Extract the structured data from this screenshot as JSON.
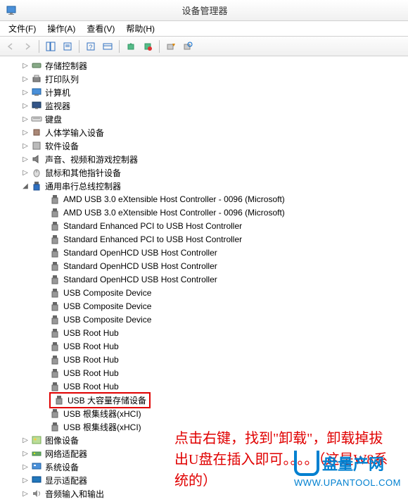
{
  "window": {
    "title": "设备管理器"
  },
  "menu": {
    "file": "文件(F)",
    "action": "操作(A)",
    "view": "查看(V)",
    "help": "帮助(H)"
  },
  "tree": {
    "categories": [
      {
        "label": "存储控制器",
        "expanded": false,
        "icon": "storage"
      },
      {
        "label": "打印队列",
        "expanded": false,
        "icon": "printer"
      },
      {
        "label": "计算机",
        "expanded": false,
        "icon": "computer"
      },
      {
        "label": "监视器",
        "expanded": false,
        "icon": "monitor"
      },
      {
        "label": "键盘",
        "expanded": false,
        "icon": "keyboard"
      },
      {
        "label": "人体学输入设备",
        "expanded": false,
        "icon": "hid"
      },
      {
        "label": "软件设备",
        "expanded": false,
        "icon": "software"
      },
      {
        "label": "声音、视频和游戏控制器",
        "expanded": false,
        "icon": "sound"
      },
      {
        "label": "鼠标和其他指针设备",
        "expanded": false,
        "icon": "mouse"
      },
      {
        "label": "通用串行总线控制器",
        "expanded": true,
        "icon": "usb",
        "children": [
          {
            "label": "AMD USB 3.0 eXtensible Host Controller - 0096 (Microsoft)"
          },
          {
            "label": "AMD USB 3.0 eXtensible Host Controller - 0096 (Microsoft)"
          },
          {
            "label": "Standard Enhanced PCI to USB Host Controller"
          },
          {
            "label": "Standard Enhanced PCI to USB Host Controller"
          },
          {
            "label": "Standard OpenHCD USB Host Controller"
          },
          {
            "label": "Standard OpenHCD USB Host Controller"
          },
          {
            "label": "Standard OpenHCD USB Host Controller"
          },
          {
            "label": "USB Composite Device"
          },
          {
            "label": "USB Composite Device"
          },
          {
            "label": "USB Composite Device"
          },
          {
            "label": "USB Root Hub"
          },
          {
            "label": "USB Root Hub"
          },
          {
            "label": "USB Root Hub"
          },
          {
            "label": "USB Root Hub"
          },
          {
            "label": "USB Root Hub"
          },
          {
            "label": "USB 大容量存储设备",
            "highlighted": true
          },
          {
            "label": "USB 根集线器(xHCI)"
          },
          {
            "label": "USB 根集线器(xHCI)"
          }
        ]
      },
      {
        "label": "图像设备",
        "expanded": false,
        "icon": "image"
      },
      {
        "label": "网络适配器",
        "expanded": false,
        "icon": "network"
      },
      {
        "label": "系统设备",
        "expanded": false,
        "icon": "system"
      },
      {
        "label": "显示适配器",
        "expanded": false,
        "icon": "display"
      },
      {
        "label": "音频输入和输出",
        "expanded": false,
        "icon": "audio"
      }
    ]
  },
  "annotation": "点击右键，找到\"卸载\"，卸载掉拔出U盘在插入即可。。。。（这是W8系统的）",
  "watermark": {
    "brand": "盘量产网",
    "url": "WWW.UPANTOOL.COM"
  }
}
